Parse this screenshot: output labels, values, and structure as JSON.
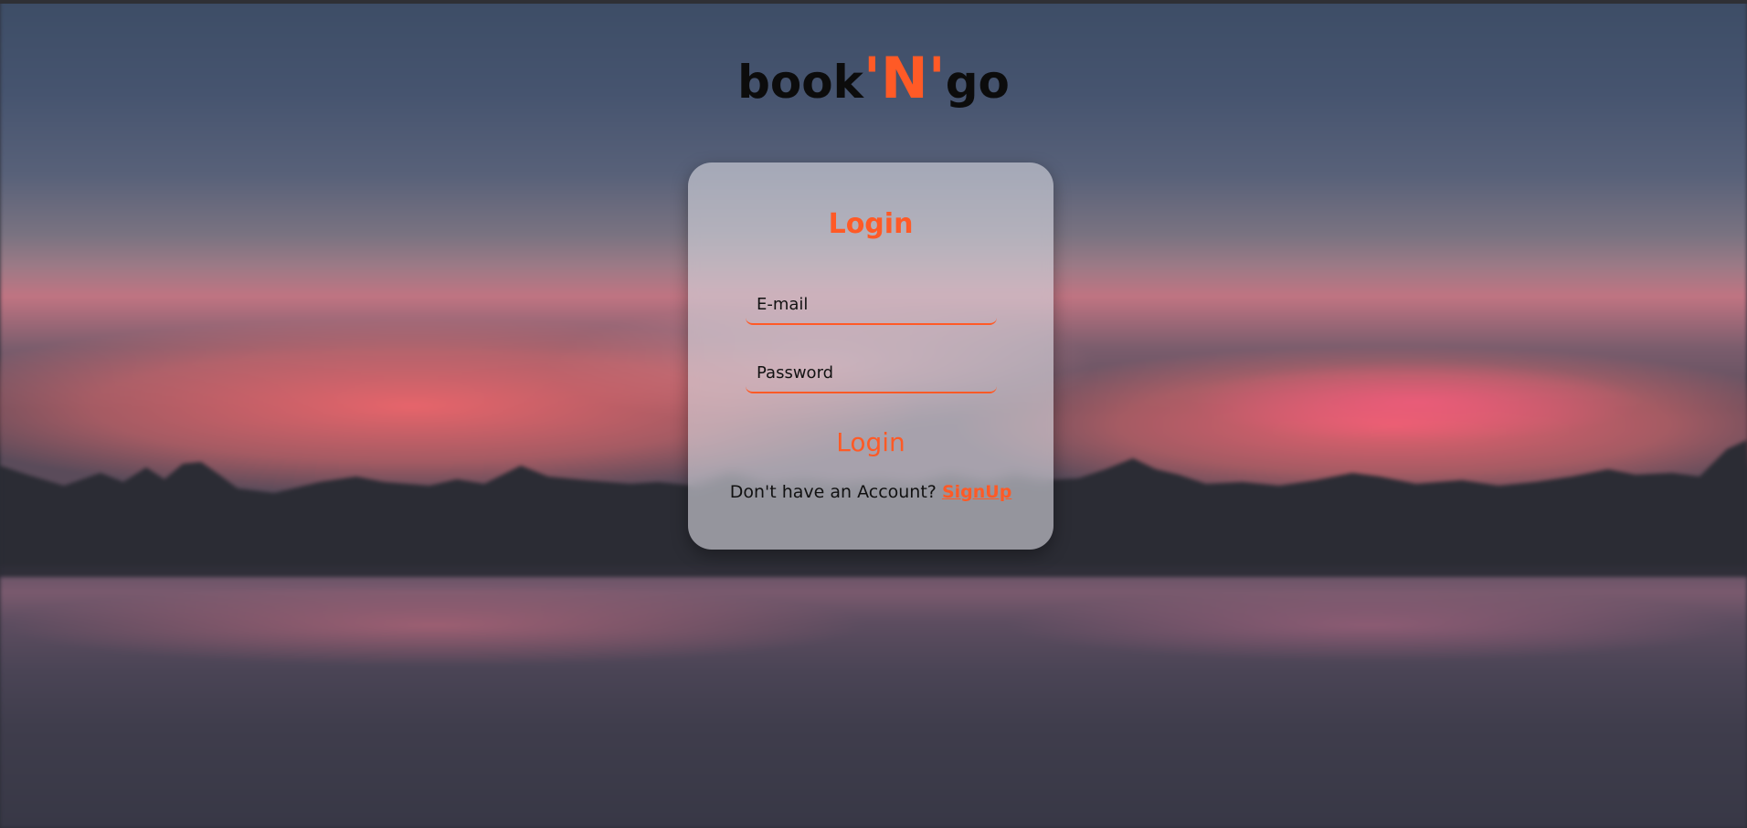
{
  "brand": {
    "prefix": "book",
    "accent": "'N'",
    "suffix": "go"
  },
  "login_card": {
    "title": "Login",
    "email_placeholder": "E-mail",
    "password_placeholder": "Password",
    "submit_label": "Login",
    "signup_prompt": "Don't have an Account?",
    "signup_link": "SignUp"
  },
  "colors": {
    "accent": "#ff5a26",
    "text": "#111111"
  }
}
